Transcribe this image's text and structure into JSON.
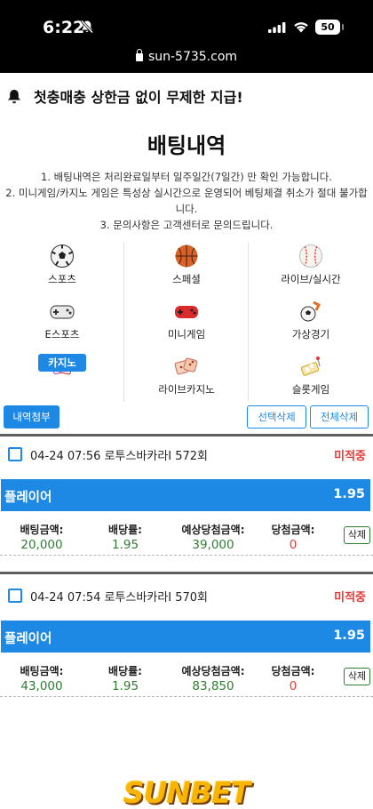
{
  "status_bar": {
    "time": "6:22",
    "battery": "50",
    "url": "sun-5735.com"
  },
  "notice": {
    "text": "첫충매충 상한금 없이 무제한 지급!"
  },
  "page": {
    "title": "배팅내역",
    "rules": [
      "1. 배팅내역은 처리완료일부터 일주일간(7일간) 만 확인 가능합니다.",
      "2. 미니게임/카지노 게임은 특성상 실시간으로 운영되어 베팅체결 취소가 절대 불가합니다.",
      "3. 문의사항은 고객센터로 문의드립니다."
    ]
  },
  "categories": [
    {
      "label": "스포츠",
      "icon": "soccer-ball-icon"
    },
    {
      "label": "스페셜",
      "icon": "basketball-icon"
    },
    {
      "label": "라이브/실시간",
      "icon": "baseball-icon"
    },
    {
      "label": "E스포츠",
      "icon": "gamepad-icon"
    },
    {
      "label": "미니게임",
      "icon": "red-gamepad-icon"
    },
    {
      "label": "가상경기",
      "icon": "soccer-kick-icon"
    },
    {
      "label": "카지노",
      "icon": "casino-cards-icon",
      "active": true
    },
    {
      "label": "라이브카지노",
      "icon": "dice-icon"
    },
    {
      "label": "슬롯게임",
      "icon": "slot-machine-icon"
    }
  ],
  "actions": {
    "history_attach": "내역첨부",
    "delete_selected": "선택삭제",
    "delete_all": "전체삭제"
  },
  "bets": [
    {
      "datetime": "04-24 07:56",
      "game": "로투스바카라I 572회",
      "status": "미적중",
      "pick": "플레이어",
      "odds": "1.95",
      "labels": {
        "amount": "배팅금액:",
        "odds": "배당률:",
        "expected": "예상당첨금액:",
        "won": "당첨금액:"
      },
      "amount": "20,000",
      "odds_value": "1.95",
      "expected": "39,000",
      "won": "0",
      "delete_label": "삭제"
    },
    {
      "datetime": "04-24 07:54",
      "game": "로투스바카라I 570회",
      "status": "미적중",
      "pick": "플레이어",
      "odds": "1.95",
      "labels": {
        "amount": "배팅금액:",
        "odds": "배당률:",
        "expected": "예상당첨금액:",
        "won": "당첨금액:"
      },
      "amount": "43,000",
      "odds_value": "1.95",
      "expected": "83,850",
      "won": "0",
      "delete_label": "삭제"
    }
  ],
  "logo": {
    "text": "SUNBET"
  },
  "colors": {
    "accent": "#1e88e5",
    "loss": "#e53935",
    "value": "#2e7d32"
  }
}
